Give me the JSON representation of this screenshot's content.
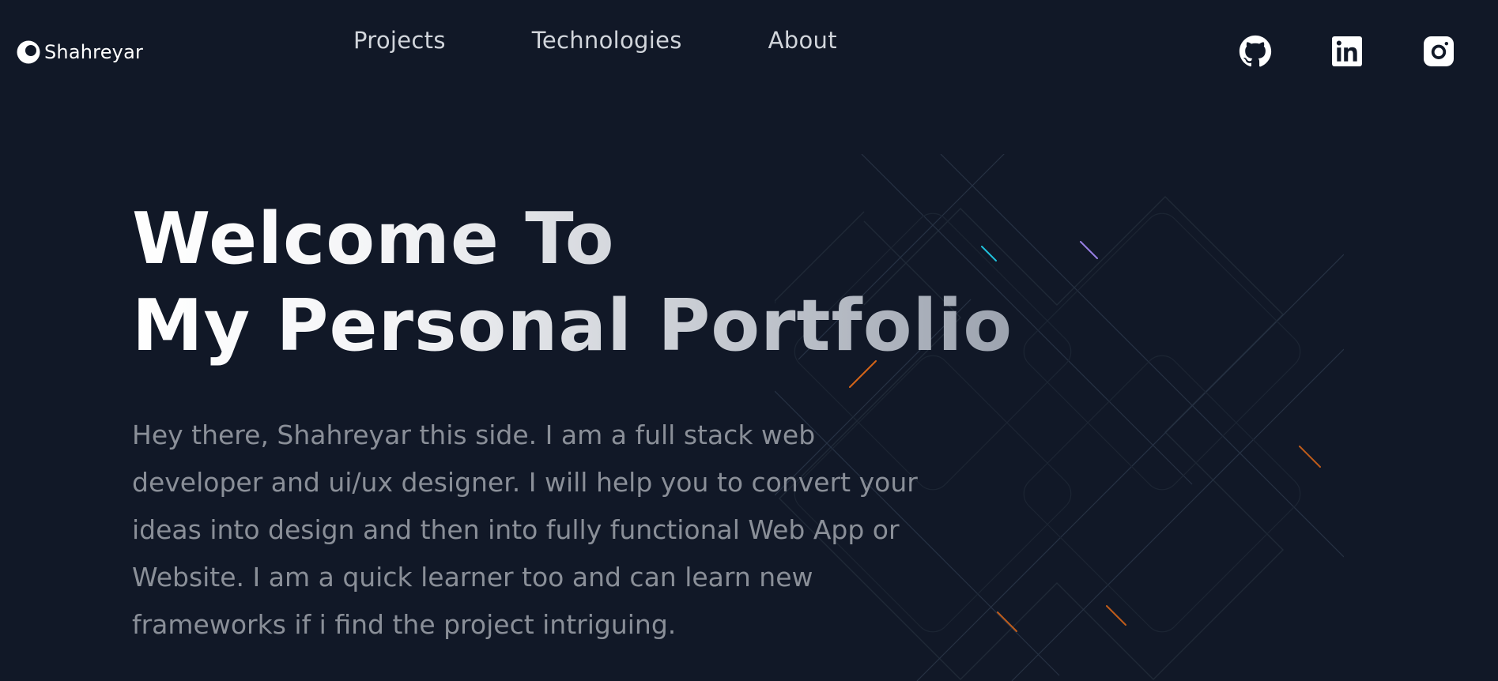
{
  "brand": {
    "name": "Shahreyar"
  },
  "nav": {
    "items": [
      {
        "label": "Projects"
      },
      {
        "label": "Technologies"
      },
      {
        "label": "About"
      }
    ]
  },
  "socials": [
    {
      "icon": "github-icon"
    },
    {
      "icon": "linkedin-icon"
    },
    {
      "icon": "instagram-icon"
    }
  ],
  "hero": {
    "title_line1": "Welcome To",
    "title_line2": "My Personal Portfolio",
    "description": "Hey there, Shahreyar this side. I am a full stack web developer and ui/ux designer. I will help you to convert your ideas into design and then into fully functional Web App or Website. I am a quick learner too and can learn new frameworks if i find the project intriguing."
  },
  "colors": {
    "background": "#111827",
    "nav_text": "#d1d5db",
    "description_text": "#8a8f98",
    "accent_orange": "#f97316",
    "accent_cyan": "#22d3ee",
    "accent_purple": "#a78bfa"
  }
}
